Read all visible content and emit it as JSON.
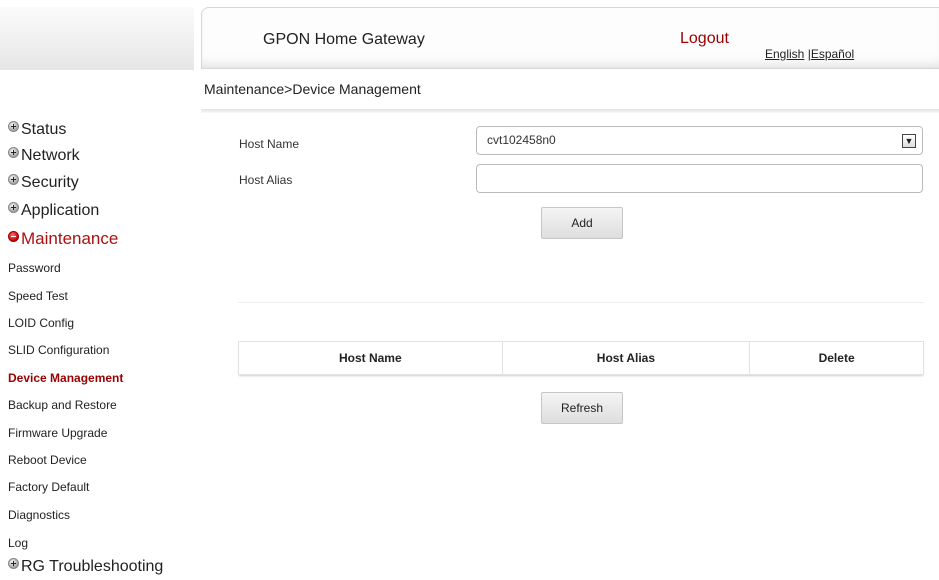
{
  "header": {
    "title": "GPON Home Gateway",
    "logout": "Logout",
    "lang_english": "English",
    "lang_separator": " |",
    "lang_spanish": "Español"
  },
  "breadcrumb": "Maintenance>Device Management",
  "sidebar": {
    "main_items": [
      {
        "label": "Status",
        "active": false
      },
      {
        "label": "Network",
        "active": false
      },
      {
        "label": "Security",
        "active": false
      },
      {
        "label": "Application",
        "active": false
      },
      {
        "label": "Maintenance",
        "active": true
      }
    ],
    "sub_items": [
      {
        "label": "Password"
      },
      {
        "label": "Speed Test"
      },
      {
        "label": "LOID Config"
      },
      {
        "label": "SLID Configuration"
      },
      {
        "label": "Device Management",
        "active": true
      },
      {
        "label": "Backup and Restore"
      },
      {
        "label": "Firmware Upgrade"
      },
      {
        "label": "Reboot Device"
      },
      {
        "label": "Factory Default"
      },
      {
        "label": "Diagnostics"
      },
      {
        "label": "Log"
      }
    ],
    "last_item": {
      "label": "RG Troubleshooting",
      "active": false
    }
  },
  "form": {
    "host_name_label": "Host Name",
    "host_name_value": "cvt102458n0",
    "host_alias_label": "Host Alias",
    "host_alias_value": "",
    "add_button": "Add"
  },
  "table": {
    "columns": [
      "Host Name",
      "Host Alias",
      "Delete"
    ]
  },
  "refresh_button": "Refresh",
  "icons": {
    "collapsed": "plus-circle-icon",
    "expanded": "minus-circle-icon",
    "dropdown": "chevron-down-icon"
  },
  "colors": {
    "accent": "#990000",
    "active_nav": "#aa1111"
  }
}
